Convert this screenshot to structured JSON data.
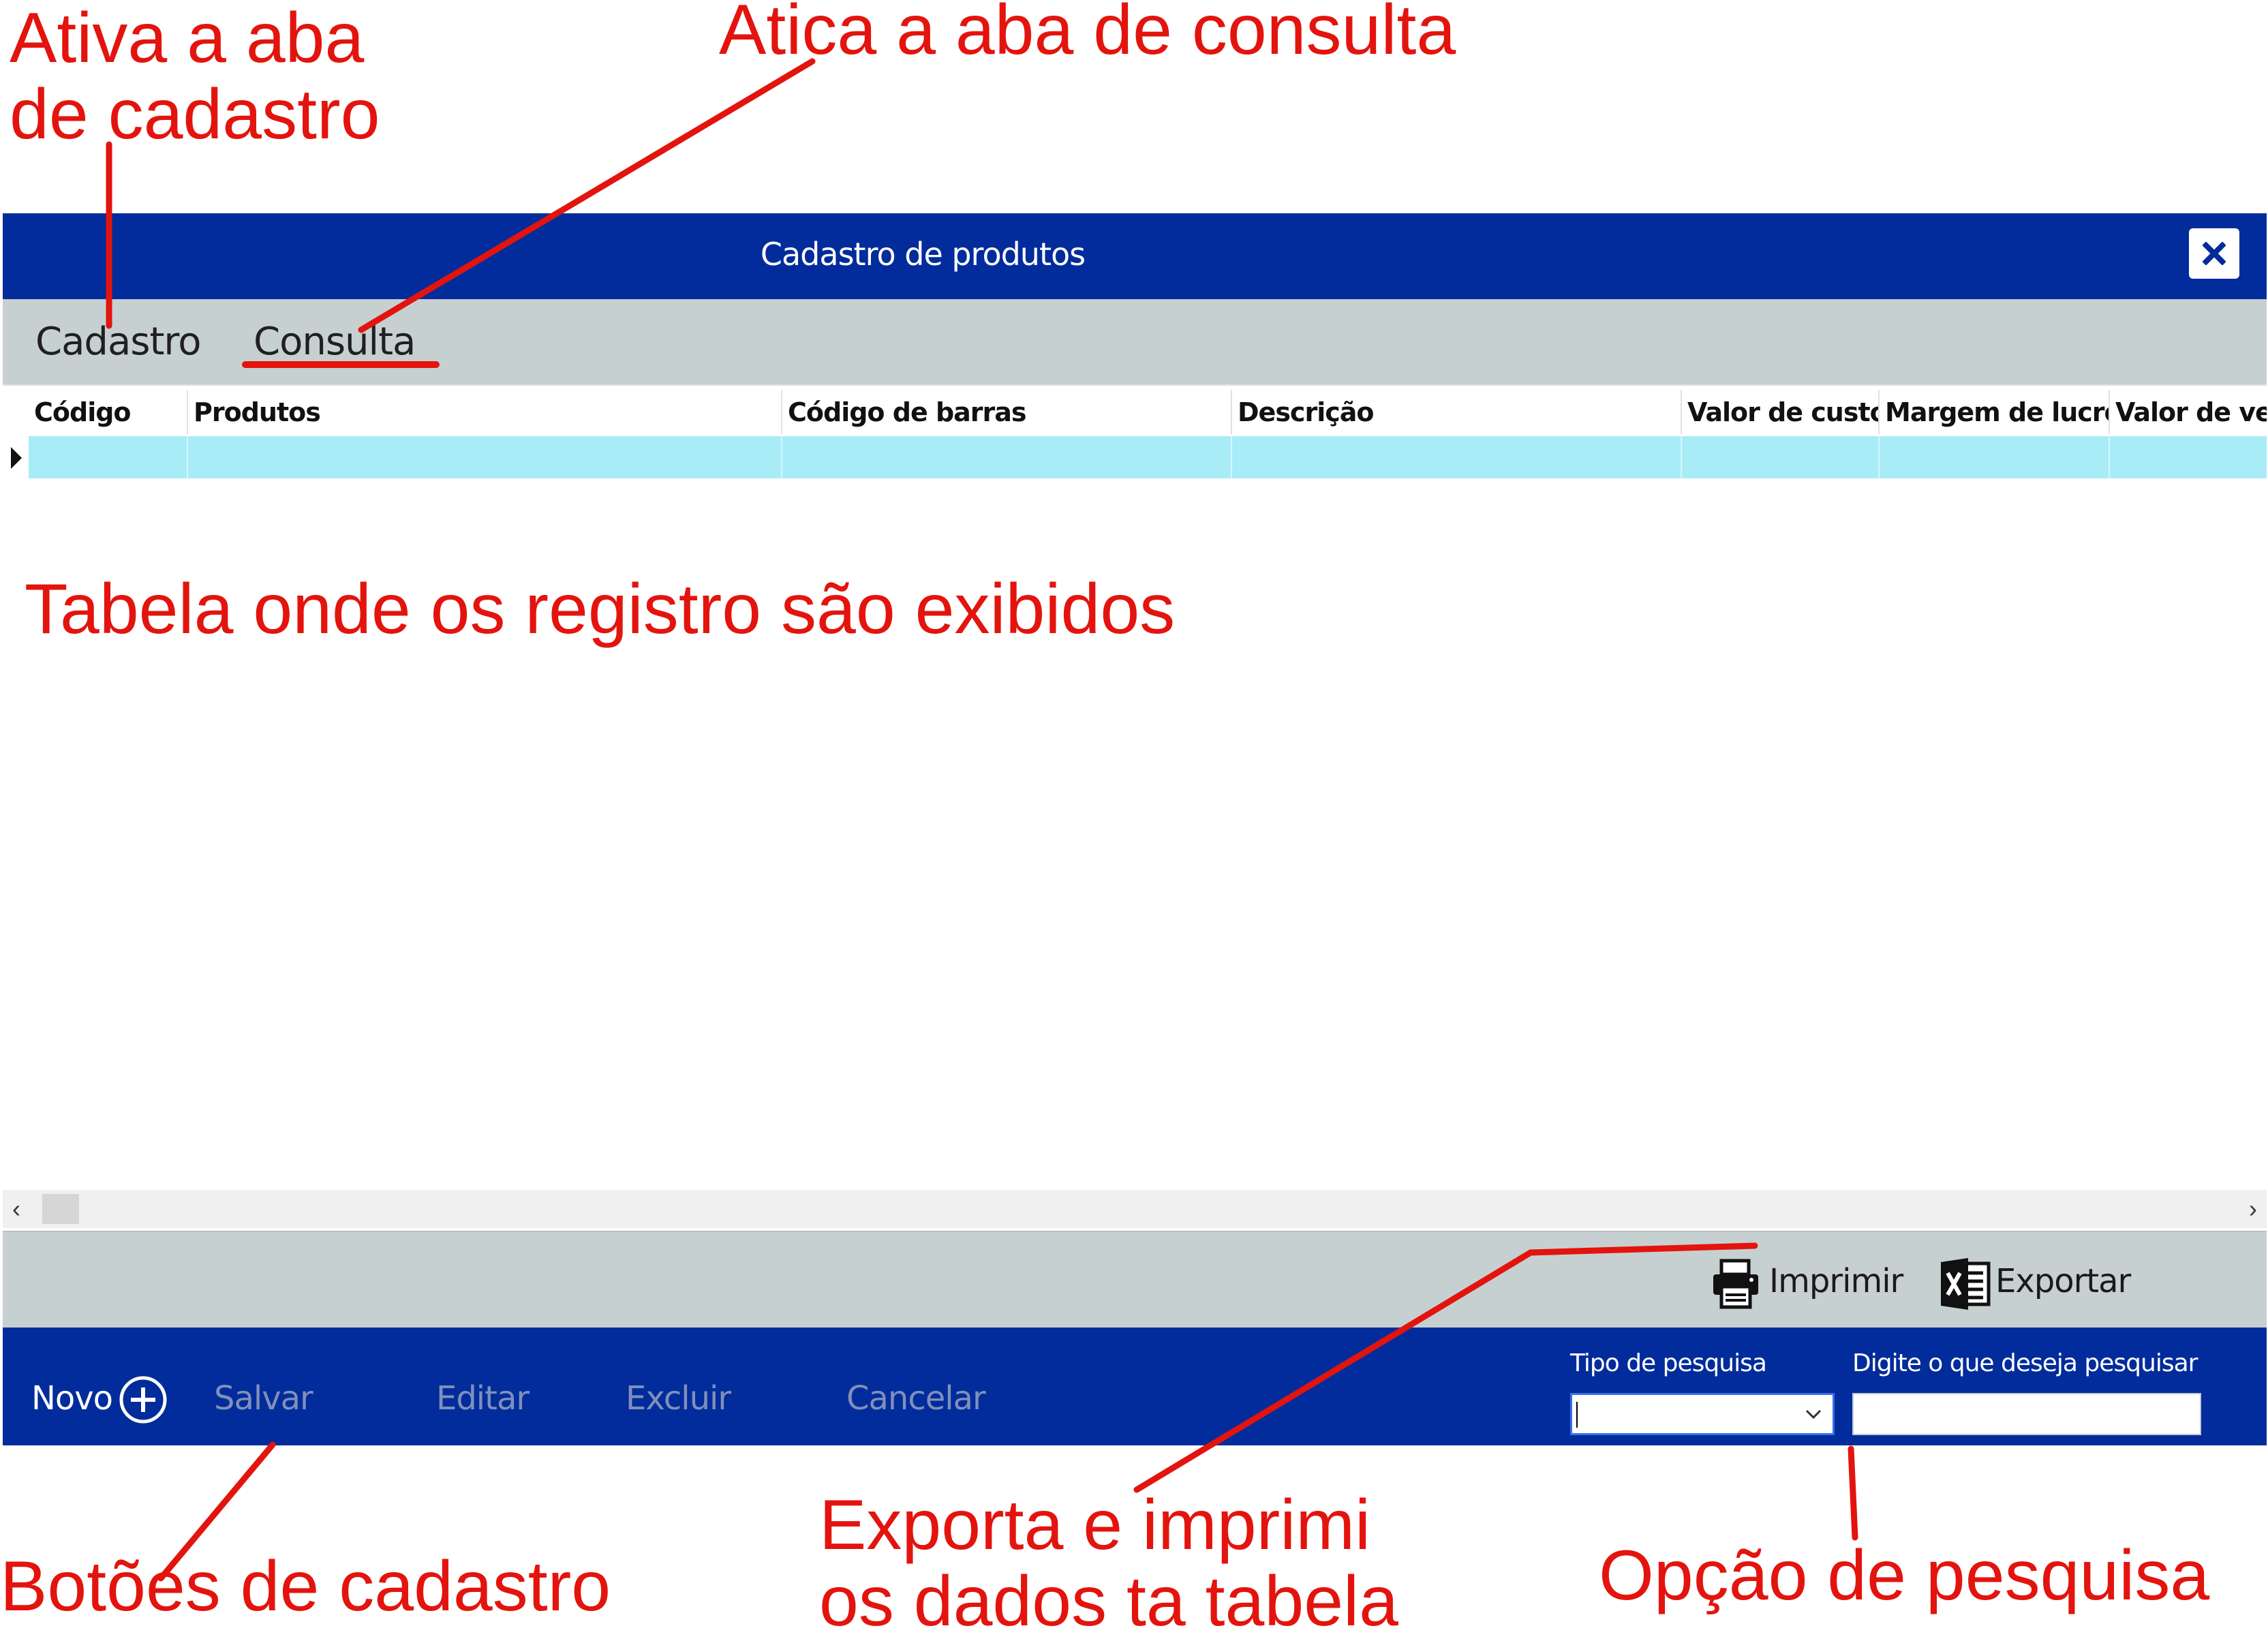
{
  "window": {
    "title": "Cadastro de produtos",
    "close_icon": "close-icon",
    "tabs": [
      {
        "label": "Cadastro"
      },
      {
        "label": "Consulta"
      }
    ]
  },
  "grid": {
    "columns": [
      "Código",
      "Produtos",
      "Código de barras",
      "Descrição",
      "Valor de custo",
      "Margem de lucro",
      "Valor de ve"
    ],
    "rows": []
  },
  "actions": {
    "print_label": "Imprimir",
    "print_icon": "printer-icon",
    "export_label": "Exportar",
    "export_icon": "excel-icon"
  },
  "buttons": {
    "novo": "Novo",
    "novo_icon": "plus-circle-icon",
    "salvar": "Salvar",
    "editar": "Editar",
    "excluir": "Excluir",
    "cancelar": "Cancelar"
  },
  "search": {
    "type_label": "Tipo de pesquisa",
    "type_value": "",
    "query_label": "Digite o que deseja pesquisar",
    "query_value": ""
  },
  "annotations": {
    "cadastro_tab": [
      "Ativa a aba",
      "de cadastro"
    ],
    "consulta_tab": "Atica a aba de consulta",
    "table": "Tabela onde os registro são exibidos",
    "crud_buttons": "Botões de cadastro",
    "export_print": [
      "Exporta e imprimi",
      "os dados ta tabela"
    ],
    "search_option": "Opção de pesquisa"
  },
  "colors": {
    "titlebar": "#022c9b",
    "toolbar": "#c7d0d0",
    "selected_row": "#a8ecf8",
    "annotation": "#e3140e",
    "disabled_button": "#8090bb"
  }
}
